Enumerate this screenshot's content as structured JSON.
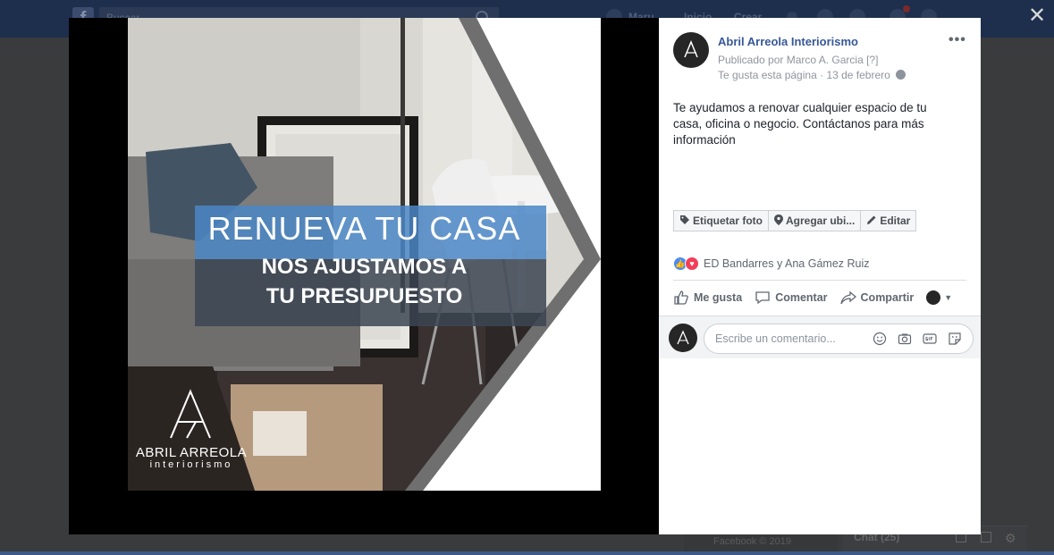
{
  "topbar": {
    "search_placeholder": "Buscar",
    "nav": [
      "Maru",
      "Inicio",
      "Crear"
    ]
  },
  "photo": {
    "headline": "RENUEVA TU CASA",
    "subline1": "NOS AJUSTAMOS A",
    "subline2": "TU PRESUPUESTO",
    "brand_name": "ABRIL ARREOLA",
    "brand_sub": "interiorismo"
  },
  "post": {
    "page_name": "Abril Arreola Interiorismo",
    "published_by": "Publicado por Marco A. Garcia",
    "published_by_mark": "[?]",
    "likes_page": "Te gusta esta página",
    "date": "13 de febrero",
    "text": "Te ayudamos a renovar cualquier espacio de tu casa, oficina o negocio. Contáctanos para más información",
    "photo_actions": {
      "tag": "Etiquetar foto",
      "location": "Agregar ubi...",
      "edit": "Editar"
    },
    "reactions_text": "ED Bandarres y Ana Gámez Ruiz",
    "ufi": {
      "like": "Me gusta",
      "comment": "Comentar",
      "share": "Compartir"
    },
    "comment_placeholder": "Escribe un comentario..."
  },
  "footer": {
    "copyright": "Facebook © 2019",
    "chat": "Chat (25)"
  },
  "colors": {
    "link_blue": "#365899",
    "like_blue": "#4a8af4",
    "love_red": "#f33e58",
    "banner_blue": "#4a86c5"
  }
}
